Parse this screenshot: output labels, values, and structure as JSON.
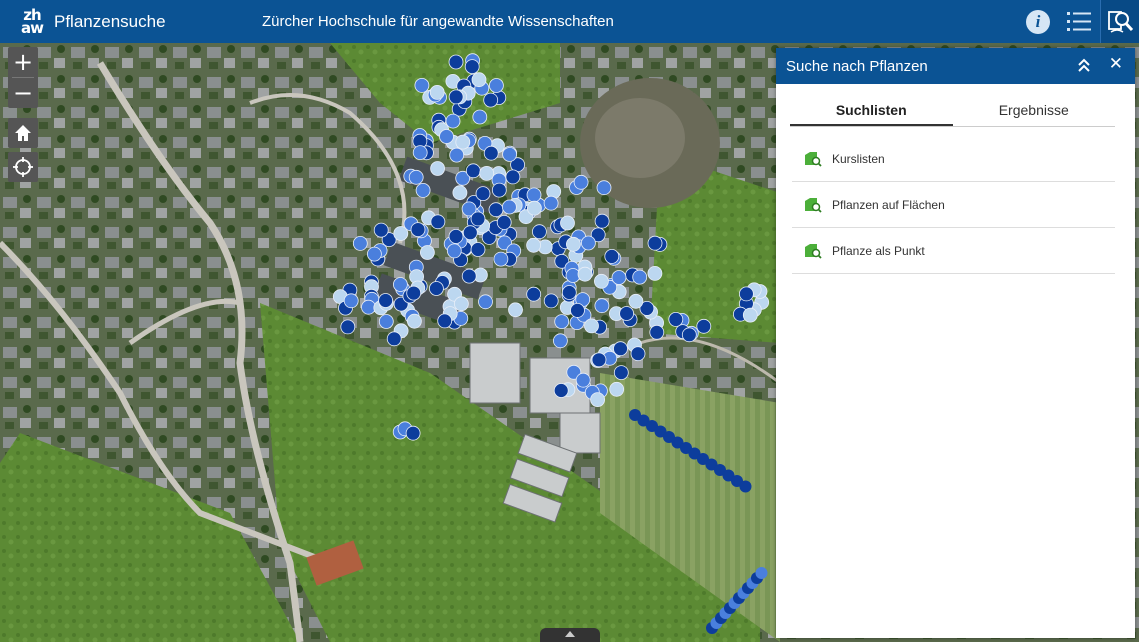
{
  "header": {
    "logo_top": "zh",
    "logo_bottom": "aw",
    "app_title": "Pflanzensuche",
    "subtitle": "Zürcher Hochschule für angewandte Wissenschaften",
    "info_icon": "info-icon",
    "list_icon": "layer-list-icon",
    "search_icon": "plant-search-icon",
    "info_glyph": "i"
  },
  "map_controls": {
    "zoom_in": "+",
    "zoom_out": "−",
    "home_icon": "home-icon",
    "locate_icon": "locate-icon"
  },
  "panel": {
    "title": "Suche nach Pflanzen",
    "collapse_icon": "double-chevron-up-icon",
    "close_glyph": "✕",
    "tabs": [
      {
        "label": "Suchlisten",
        "active": true
      },
      {
        "label": "Ergebnisse",
        "active": false
      }
    ],
    "items": [
      {
        "label": "Kurslisten",
        "icon": "layer-search-icon"
      },
      {
        "label": "Pflanzen auf Flächen",
        "icon": "layer-search-icon"
      },
      {
        "label": "Pflanze als Punkt",
        "icon": "layer-search-icon"
      }
    ]
  },
  "colors": {
    "header_bg": "#0b5394",
    "point_dark": "#0d3d9c",
    "point_mid": "#4a7fdd",
    "point_light": "#bcd7f0",
    "icon_green": "#4caf3a"
  }
}
